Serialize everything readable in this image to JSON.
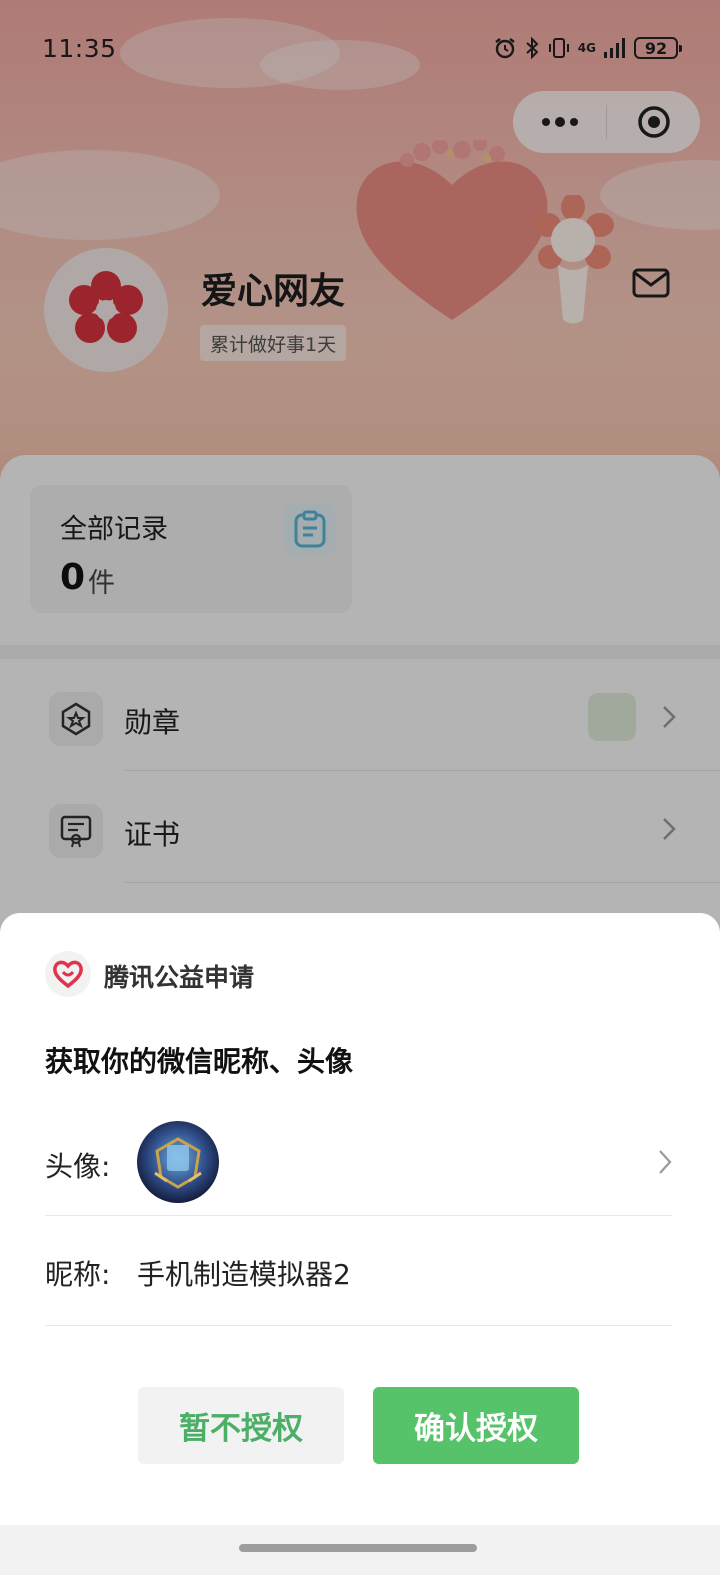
{
  "status_bar": {
    "time": "11:35",
    "network": "4G",
    "battery": "92"
  },
  "profile": {
    "username": "爱心网友",
    "days_label": "累计做好事1天"
  },
  "records": {
    "title": "全部记录",
    "count": "0",
    "unit": "件"
  },
  "menu": {
    "items": [
      {
        "label": "勋章",
        "icon": "medal-icon"
      },
      {
        "label": "证书",
        "icon": "certificate-icon"
      }
    ]
  },
  "auth_sheet": {
    "app_name": "腾讯公益申请",
    "title": "获取你的微信昵称、头像",
    "avatar_label": "头像:",
    "nickname_label": "昵称:",
    "nickname_value": "手机制造模拟器2",
    "deny_button": "暂不授权",
    "allow_button": "确认授权"
  },
  "colors": {
    "accent_green": "#56c26a",
    "deny_text_green": "#4caf67",
    "hero_pink": "#f3aaa3",
    "flower_red": "#d9333d"
  }
}
